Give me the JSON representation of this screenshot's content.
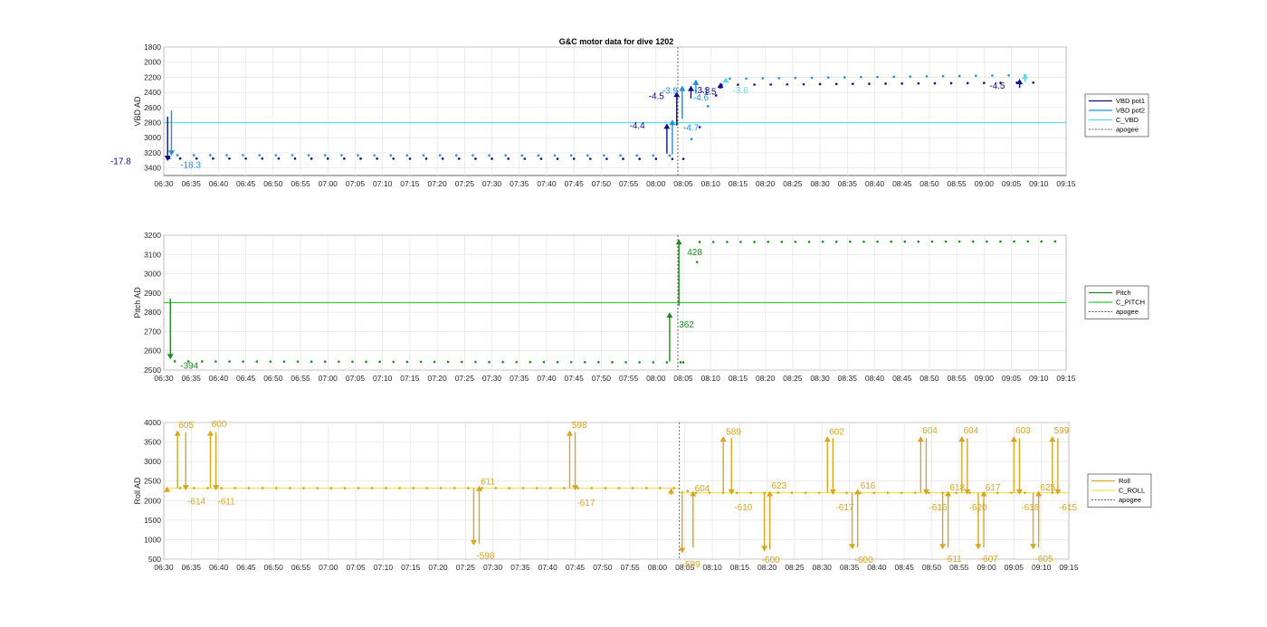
{
  "title": "G&C motor data for dive 1202",
  "colors": {
    "pot1": "#0a0f8c",
    "pot2": "#1f8fe0",
    "cvbd": "#5fd9e8",
    "pitch": "#218a21",
    "cpitch": "#33cc33",
    "roll": "#d9a521",
    "croll": "#f2e15a",
    "apogee": "#555555"
  },
  "chart_data": [
    {
      "type": "scatter",
      "ylabel": "VBD AD",
      "yticks": [
        1800,
        2000,
        2200,
        2400,
        2600,
        2800,
        3000,
        3200,
        3400
      ],
      "ylim": [
        1800,
        3500
      ],
      "reversed": true,
      "xticks": [
        "06:30",
        "06:35",
        "06:40",
        "06:45",
        "06:50",
        "06:55",
        "07:00",
        "07:05",
        "07:10",
        "07:15",
        "07:20",
        "07:25",
        "07:30",
        "07:35",
        "07:40",
        "07:45",
        "07:50",
        "07:55",
        "08:00",
        "08:05",
        "08:10",
        "08:15",
        "08:20",
        "08:25",
        "08:30",
        "08:35",
        "08:40",
        "08:45",
        "08:50",
        "08:55",
        "09:00",
        "09:05",
        "09:10",
        "09:15"
      ],
      "xlim_min": [
        0,
        165
      ],
      "apogee_min": 94,
      "legend": {
        "position": "right",
        "entries": [
          {
            "label": "VBD pot1",
            "color": "pot1",
            "dash": false
          },
          {
            "label": "VBD pot2",
            "color": "pot2",
            "dash": false
          },
          {
            "label": "C_VBD",
            "color": "cvbd",
            "dash": false
          },
          {
            "label": "apogee",
            "color": "apogee",
            "dash": true
          }
        ]
      },
      "hlines": [
        {
          "y": 2800,
          "color": "cvbd"
        }
      ],
      "series": [
        {
          "name": "VBD pot1",
          "color": "pot1",
          "step_min": 3,
          "points": [
            [
              1,
              3270
            ],
            [
              3,
              3275
            ],
            [
              95,
              3280
            ],
            [
              102,
              2300
            ],
            [
              160,
              2270
            ]
          ]
        },
        {
          "name": "VBD pot2",
          "color": "pot2",
          "step_min": 3,
          "offset_min": 1.5,
          "points": [
            [
              1,
              3230
            ],
            [
              95,
              3235
            ],
            [
              102,
              2220
            ],
            [
              160,
              2170
            ]
          ]
        }
      ],
      "arrows": [
        {
          "x": 0.7,
          "y0": 2720,
          "y1": 3310,
          "color": "pot1",
          "label": "-17.8",
          "lx": -6,
          "ly": 3305,
          "anchor": "end"
        },
        {
          "x": 1.4,
          "y0": 2640,
          "y1": 3240,
          "color": "pot2",
          "label": "-18.3",
          "lx": 3,
          "ly": 3350,
          "anchor": "start"
        },
        {
          "x": 92.0,
          "y0": 3210,
          "y1": 2810,
          "color": "pot1",
          "label": "-4.4",
          "lx": 88,
          "ly": 2830,
          "anchor": "end"
        },
        {
          "x": 93.0,
          "y0": 3220,
          "y1": 2760,
          "color": "pot2",
          "label": "-4.7",
          "lx": 95,
          "ly": 2860,
          "anchor": "start"
        },
        {
          "x": 93.8,
          "y0": 2840,
          "y1": 2390,
          "color": "pot1",
          "label": "-4.5",
          "lx": 91.5,
          "ly": 2440,
          "anchor": "end"
        },
        {
          "x": 94.8,
          "y0": 2750,
          "y1": 2310,
          "color": "pot2",
          "label": "-3.9",
          "lx": 94,
          "ly": 2370,
          "anchor": "end"
        },
        {
          "x": 96.4,
          "y0": 2480,
          "y1": 2310,
          "color": "pot1",
          "label": "-3.3",
          "lx": 97,
          "ly": 2360,
          "anchor": "start"
        },
        {
          "x": 97.3,
          "y0": 2420,
          "y1": 2230,
          "color": "pot2",
          "label": "-4.6",
          "lx": 96.8,
          "ly": 2460,
          "anchor": "start"
        },
        {
          "x": 101.8,
          "y0": 2350,
          "y1": 2270,
          "color": "pot1",
          "label": "-1.5",
          "lx": 98.2,
          "ly": 2380,
          "anchor": "start"
        },
        {
          "x": 102.8,
          "y0": 2250,
          "y1": 2200,
          "color": "cvbd",
          "label": "-3.6",
          "lx": 104,
          "ly": 2360,
          "anchor": "start"
        },
        {
          "x": 156.5,
          "y0": 2340,
          "y1": 2220,
          "color": "pot1",
          "label": "-4.5",
          "lx": 151,
          "ly": 2300,
          "anchor": "start"
        },
        {
          "x": 157.5,
          "y0": 2260,
          "y1": 2150,
          "color": "cvbd",
          "label": "",
          "lx": 0,
          "ly": 0,
          "anchor": "start"
        }
      ]
    },
    {
      "type": "scatter",
      "ylabel": "Pitch AD",
      "yticks": [
        2500,
        2600,
        2700,
        2800,
        2900,
        3000,
        3100,
        3200
      ],
      "ylim": [
        2500,
        3200
      ],
      "reversed": false,
      "xticks": [
        "06:30",
        "06:35",
        "06:40",
        "06:45",
        "06:50",
        "06:55",
        "07:00",
        "07:05",
        "07:10",
        "07:15",
        "07:20",
        "07:25",
        "07:30",
        "07:35",
        "07:40",
        "07:45",
        "07:50",
        "07:55",
        "08:00",
        "08:05",
        "08:10",
        "08:15",
        "08:20",
        "08:25",
        "08:30",
        "08:35",
        "08:40",
        "08:45",
        "08:50",
        "08:55",
        "09:00",
        "09:05",
        "09:10",
        "09:15"
      ],
      "xlim_min": [
        0,
        165
      ],
      "apogee_min": 94,
      "legend": {
        "position": "right",
        "entries": [
          {
            "label": "Pitch",
            "color": "pitch",
            "dash": false
          },
          {
            "label": "C_PITCH",
            "color": "cpitch",
            "dash": false
          },
          {
            "label": "apogee",
            "color": "apogee",
            "dash": true
          }
        ]
      },
      "hlines": [
        {
          "y": 2850,
          "color": "cpitch"
        }
      ],
      "series": [
        {
          "name": "Pitch",
          "color": "pitch",
          "step_min": 2.5,
          "points": [
            [
              2,
              2545
            ],
            [
              95,
              2540
            ],
            [
              98,
              3165
            ],
            [
              164,
              3168
            ]
          ]
        }
      ],
      "arrows": [
        {
          "x": 1.2,
          "y0": 2870,
          "y1": 2555,
          "color": "pitch",
          "label": "-394",
          "lx": 3,
          "ly": 2525,
          "anchor": "start"
        },
        {
          "x": 92.5,
          "y0": 2545,
          "y1": 2800,
          "color": "pitch",
          "label": "362",
          "lx": 94.2,
          "ly": 2740,
          "anchor": "start"
        },
        {
          "x": 94.2,
          "y0": 2835,
          "y1": 3180,
          "color": "pitch",
          "label": "428",
          "lx": 95.7,
          "ly": 3115,
          "anchor": "start"
        }
      ]
    },
    {
      "type": "scatter",
      "ylabel": "Roll AD",
      "yticks": [
        500,
        1000,
        1500,
        2000,
        2500,
        3000,
        3500,
        4000
      ],
      "ylim": [
        500,
        4000
      ],
      "reversed": false,
      "xticks": [
        "06:30",
        "06:35",
        "06:40",
        "06:45",
        "06:50",
        "06:55",
        "07:00",
        "07:05",
        "07:10",
        "07:15",
        "07:20",
        "07:25",
        "07:30",
        "07:35",
        "07:40",
        "07:45",
        "07:50",
        "07:55",
        "08:00",
        "08:05",
        "08:10",
        "08:15",
        "08:20",
        "08:25",
        "08:30",
        "08:35",
        "08:40",
        "08:45",
        "08:50",
        "08:55",
        "09:00",
        "09:05",
        "09:10",
        "09:15"
      ],
      "xlim_min": [
        0,
        165
      ],
      "apogee_min": 94,
      "legend": {
        "position": "right",
        "entries": [
          {
            "label": "Roll",
            "color": "roll",
            "dash": false
          },
          {
            "label": "C_ROLL",
            "color": "croll",
            "dash": false
          },
          {
            "label": "apogee",
            "color": "apogee",
            "dash": true
          }
        ]
      },
      "hlines": [
        {
          "y": 2320,
          "color": "croll",
          "x0": 0,
          "x1": 94
        },
        {
          "y": 2200,
          "color": "croll",
          "x0": 94,
          "x1": 165
        }
      ],
      "series": [
        {
          "name": "Roll",
          "color": "roll",
          "step_min": 2.5,
          "points": [
            [
              3,
              2320
            ],
            [
              93,
              2320
            ],
            [
              97,
              2200
            ],
            [
              164,
              2200
            ]
          ]
        }
      ],
      "arrows": [
        {
          "x": 0.6,
          "y0": 2280,
          "y1": 2360,
          "color": "roll",
          "label": "",
          "lx": 0,
          "ly": 0,
          "anchor": "start"
        },
        {
          "x": 2.5,
          "y0": 2320,
          "y1": 3800,
          "color": "roll",
          "label": "605",
          "lx": 2.7,
          "ly": 3950,
          "anchor": "start"
        },
        {
          "x": 4.0,
          "y0": 3750,
          "y1": 2260,
          "color": "roll",
          "label": "-614",
          "lx": 4.3,
          "ly": 2000,
          "anchor": "start"
        },
        {
          "x": 8.5,
          "y0": 2320,
          "y1": 3800,
          "color": "roll",
          "label": "600",
          "lx": 8.7,
          "ly": 3980,
          "anchor": "start"
        },
        {
          "x": 9.5,
          "y0": 3750,
          "y1": 2260,
          "color": "roll",
          "label": "-611",
          "lx": 9.8,
          "ly": 2000,
          "anchor": "start"
        },
        {
          "x": 56.5,
          "y0": 2320,
          "y1": 850,
          "color": "roll",
          "label": "-598",
          "lx": 57,
          "ly": 600,
          "anchor": "start"
        },
        {
          "x": 57.5,
          "y0": 900,
          "y1": 2380,
          "color": "roll",
          "label": "611",
          "lx": 57.8,
          "ly": 2500,
          "anchor": "start"
        },
        {
          "x": 74.0,
          "y0": 2320,
          "y1": 3800,
          "color": "roll",
          "label": "598",
          "lx": 74.4,
          "ly": 3950,
          "anchor": "start"
        },
        {
          "x": 75.0,
          "y0": 3750,
          "y1": 2260,
          "color": "roll",
          "label": "-617",
          "lx": 75.3,
          "ly": 1960,
          "anchor": "start"
        },
        {
          "x": 92.5,
          "y0": 2150,
          "y1": 2320,
          "color": "roll",
          "label": "",
          "lx": 0,
          "ly": 0,
          "anchor": "start"
        },
        {
          "x": 94.5,
          "y0": 2250,
          "y1": 650,
          "color": "roll",
          "label": "-589",
          "lx": 94.5,
          "ly": 380,
          "anchor": "start"
        },
        {
          "x": 96.5,
          "y0": 800,
          "y1": 2250,
          "color": "roll",
          "label": "604",
          "lx": 96.8,
          "ly": 2330,
          "anchor": "start"
        },
        {
          "x": 102.0,
          "y0": 2200,
          "y1": 3650,
          "color": "roll",
          "label": "589",
          "lx": 102.5,
          "ly": 3780,
          "anchor": "start"
        },
        {
          "x": 103.5,
          "y0": 3600,
          "y1": 2150,
          "color": "roll",
          "label": "-610",
          "lx": 104,
          "ly": 1850,
          "anchor": "start"
        },
        {
          "x": 109.5,
          "y0": 2200,
          "y1": 700,
          "color": "roll",
          "label": "-600",
          "lx": 109,
          "ly": 500,
          "anchor": "start"
        },
        {
          "x": 110.5,
          "y0": 750,
          "y1": 2250,
          "color": "roll",
          "label": "623",
          "lx": 110.8,
          "ly": 2400,
          "anchor": "start"
        },
        {
          "x": 121.0,
          "y0": 2200,
          "y1": 3650,
          "color": "roll",
          "label": "602",
          "lx": 121.3,
          "ly": 3780,
          "anchor": "start"
        },
        {
          "x": 122.0,
          "y0": 3600,
          "y1": 2150,
          "color": "roll",
          "label": "-617",
          "lx": 122.5,
          "ly": 1850,
          "anchor": "start"
        },
        {
          "x": 125.5,
          "y0": 2200,
          "y1": 750,
          "color": "roll",
          "label": "-600",
          "lx": 126,
          "ly": 500,
          "anchor": "start"
        },
        {
          "x": 126.5,
          "y0": 800,
          "y1": 2300,
          "color": "roll",
          "label": "616",
          "lx": 127,
          "ly": 2400,
          "anchor": "start"
        },
        {
          "x": 138.0,
          "y0": 2200,
          "y1": 3650,
          "color": "roll",
          "label": "604",
          "lx": 138.3,
          "ly": 3820,
          "anchor": "start"
        },
        {
          "x": 139.0,
          "y0": 3600,
          "y1": 2150,
          "color": "roll",
          "label": "-616",
          "lx": 139.5,
          "ly": 1850,
          "anchor": "start"
        },
        {
          "x": 142.0,
          "y0": 2200,
          "y1": 750,
          "color": "roll",
          "label": "-611",
          "lx": 142.3,
          "ly": 520,
          "anchor": "start"
        },
        {
          "x": 143.0,
          "y0": 800,
          "y1": 2250,
          "color": "roll",
          "label": "618",
          "lx": 143.3,
          "ly": 2350,
          "anchor": "start"
        },
        {
          "x": 145.5,
          "y0": 2200,
          "y1": 3650,
          "color": "roll",
          "label": "604",
          "lx": 145.8,
          "ly": 3820,
          "anchor": "start"
        },
        {
          "x": 146.5,
          "y0": 3600,
          "y1": 2150,
          "color": "roll",
          "label": "-620",
          "lx": 146.8,
          "ly": 1850,
          "anchor": "start"
        },
        {
          "x": 148.5,
          "y0": 2200,
          "y1": 750,
          "color": "roll",
          "label": "-607",
          "lx": 148.8,
          "ly": 520,
          "anchor": "start"
        },
        {
          "x": 149.5,
          "y0": 800,
          "y1": 2250,
          "color": "roll",
          "label": "617",
          "lx": 149.8,
          "ly": 2350,
          "anchor": "start"
        },
        {
          "x": 155.0,
          "y0": 2200,
          "y1": 3650,
          "color": "roll",
          "label": "603",
          "lx": 155.3,
          "ly": 3820,
          "anchor": "start"
        },
        {
          "x": 156.0,
          "y0": 3600,
          "y1": 2150,
          "color": "roll",
          "label": "-618",
          "lx": 156.3,
          "ly": 1850,
          "anchor": "start"
        },
        {
          "x": 158.5,
          "y0": 2200,
          "y1": 750,
          "color": "roll",
          "label": "-605",
          "lx": 158.8,
          "ly": 520,
          "anchor": "start"
        },
        {
          "x": 159.5,
          "y0": 800,
          "y1": 2250,
          "color": "roll",
          "label": "625",
          "lx": 159.8,
          "ly": 2350,
          "anchor": "start"
        },
        {
          "x": 162.0,
          "y0": 2200,
          "y1": 3650,
          "color": "roll",
          "label": "599",
          "lx": 162.3,
          "ly": 3820,
          "anchor": "start"
        },
        {
          "x": 163.0,
          "y0": 3600,
          "y1": 2150,
          "color": "roll",
          "label": "-615",
          "lx": 163.2,
          "ly": 1850,
          "anchor": "start"
        }
      ]
    }
  ]
}
